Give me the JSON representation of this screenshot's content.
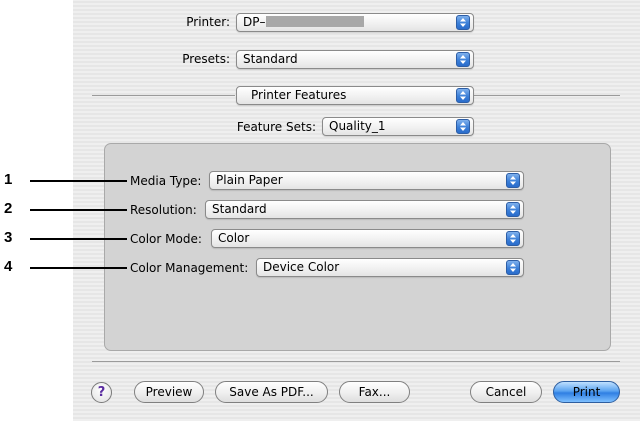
{
  "printer": {
    "label": "Printer:",
    "value": "DP–"
  },
  "presets": {
    "label": "Presets:",
    "value": "Standard"
  },
  "panel_select": {
    "value": "Printer Features"
  },
  "feature_sets": {
    "label": "Feature Sets:",
    "value": "Quality_1"
  },
  "features": [
    {
      "callout": "1",
      "label": "Media Type:",
      "value": "Plain Paper"
    },
    {
      "callout": "2",
      "label": "Resolution:",
      "value": "Standard"
    },
    {
      "callout": "3",
      "label": "Color Mode:",
      "value": "Color"
    },
    {
      "callout": "4",
      "label": "Color Management:",
      "value": "Device Color"
    }
  ],
  "buttons": {
    "help": "?",
    "preview": "Preview",
    "save_pdf": "Save As PDF...",
    "fax": "Fax...",
    "cancel": "Cancel",
    "print": "Print"
  },
  "colors": {
    "default_button": "#2f7fe3",
    "popup_arrows": "#3b7fd8",
    "help_glyph": "#5a2ca0"
  }
}
